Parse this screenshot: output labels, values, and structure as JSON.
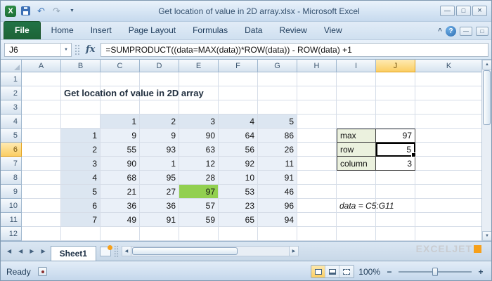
{
  "window": {
    "title": "Get location of value in 2D array.xlsx  -  Microsoft Excel"
  },
  "ribbon": {
    "tabs": [
      {
        "label": "File",
        "style": "file"
      },
      {
        "label": "Home"
      },
      {
        "label": "Insert"
      },
      {
        "label": "Page Layout"
      },
      {
        "label": "Formulas"
      },
      {
        "label": "Data"
      },
      {
        "label": "Review"
      },
      {
        "label": "View"
      }
    ]
  },
  "formula_bar": {
    "name_box": "J6",
    "fx_label": "fx",
    "formula": "=SUMPRODUCT((data=MAX(data))*ROW(data)) - ROW(data) +1"
  },
  "sheet": {
    "columns": [
      "A",
      "B",
      "C",
      "D",
      "E",
      "F",
      "G",
      "H",
      "I",
      "J",
      "K"
    ],
    "rows": [
      "1",
      "2",
      "3",
      "4",
      "5",
      "6",
      "7",
      "8",
      "9",
      "10",
      "11",
      "12"
    ],
    "selected_cell": "J6",
    "selected_column": "J",
    "selected_row": "6",
    "cells": [
      {
        "ref": "B2",
        "text": "Get location of value in 2D array",
        "type": "title"
      },
      {
        "ref": "C4",
        "text": "1",
        "type": "thead"
      },
      {
        "ref": "D4",
        "text": "2",
        "type": "thead"
      },
      {
        "ref": "E4",
        "text": "3",
        "type": "thead"
      },
      {
        "ref": "F4",
        "text": "4",
        "type": "thead"
      },
      {
        "ref": "G4",
        "text": "5",
        "type": "thead"
      },
      {
        "ref": "B5",
        "text": "1",
        "type": "thead"
      },
      {
        "ref": "C5",
        "text": "9",
        "type": "tdata"
      },
      {
        "ref": "D5",
        "text": "9",
        "type": "tdata"
      },
      {
        "ref": "E5",
        "text": "90",
        "type": "tdata"
      },
      {
        "ref": "F5",
        "text": "64",
        "type": "tdata"
      },
      {
        "ref": "G5",
        "text": "86",
        "type": "tdata"
      },
      {
        "ref": "B6",
        "text": "2",
        "type": "thead"
      },
      {
        "ref": "C6",
        "text": "55",
        "type": "tdata"
      },
      {
        "ref": "D6",
        "text": "93",
        "type": "tdata"
      },
      {
        "ref": "E6",
        "text": "63",
        "type": "tdata"
      },
      {
        "ref": "F6",
        "text": "56",
        "type": "tdata"
      },
      {
        "ref": "G6",
        "text": "26",
        "type": "tdata"
      },
      {
        "ref": "B7",
        "text": "3",
        "type": "thead"
      },
      {
        "ref": "C7",
        "text": "90",
        "type": "tdata"
      },
      {
        "ref": "D7",
        "text": "1",
        "type": "tdata"
      },
      {
        "ref": "E7",
        "text": "12",
        "type": "tdata"
      },
      {
        "ref": "F7",
        "text": "92",
        "type": "tdata"
      },
      {
        "ref": "G7",
        "text": "11",
        "type": "tdata"
      },
      {
        "ref": "B8",
        "text": "4",
        "type": "thead"
      },
      {
        "ref": "C8",
        "text": "68",
        "type": "tdata"
      },
      {
        "ref": "D8",
        "text": "95",
        "type": "tdata"
      },
      {
        "ref": "E8",
        "text": "28",
        "type": "tdata"
      },
      {
        "ref": "F8",
        "text": "10",
        "type": "tdata"
      },
      {
        "ref": "G8",
        "text": "91",
        "type": "tdata"
      },
      {
        "ref": "B9",
        "text": "5",
        "type": "thead"
      },
      {
        "ref": "C9",
        "text": "21",
        "type": "tdata"
      },
      {
        "ref": "D9",
        "text": "27",
        "type": "tdata"
      },
      {
        "ref": "E9",
        "text": "97",
        "type": "tdata max"
      },
      {
        "ref": "F9",
        "text": "53",
        "type": "tdata"
      },
      {
        "ref": "G9",
        "text": "46",
        "type": "tdata"
      },
      {
        "ref": "B10",
        "text": "6",
        "type": "thead"
      },
      {
        "ref": "C10",
        "text": "36",
        "type": "tdata"
      },
      {
        "ref": "D10",
        "text": "36",
        "type": "tdata"
      },
      {
        "ref": "E10",
        "text": "57",
        "type": "tdata"
      },
      {
        "ref": "F10",
        "text": "23",
        "type": "tdata"
      },
      {
        "ref": "G10",
        "text": "96",
        "type": "tdata"
      },
      {
        "ref": "B11",
        "text": "7",
        "type": "thead"
      },
      {
        "ref": "C11",
        "text": "49",
        "type": "tdata"
      },
      {
        "ref": "D11",
        "text": "91",
        "type": "tdata"
      },
      {
        "ref": "E11",
        "text": "59",
        "type": "tdata"
      },
      {
        "ref": "F11",
        "text": "65",
        "type": "tdata"
      },
      {
        "ref": "G11",
        "text": "94",
        "type": "tdata"
      },
      {
        "ref": "I5",
        "text": "max",
        "type": "rlabel rt"
      },
      {
        "ref": "J5",
        "text": "97",
        "type": "rvalue rt"
      },
      {
        "ref": "I6",
        "text": "row",
        "type": "rlabel"
      },
      {
        "ref": "J6",
        "text": "5",
        "type": "rvalue"
      },
      {
        "ref": "I7",
        "text": "column",
        "type": "rlabel"
      },
      {
        "ref": "J7",
        "text": "3",
        "type": "rvalue"
      },
      {
        "ref": "I10",
        "text": "data = C5:G11",
        "type": "note"
      }
    ]
  },
  "sheet_tabs": {
    "tabs": [
      {
        "label": "Sheet1",
        "active": true
      }
    ]
  },
  "status_bar": {
    "mode": "Ready",
    "zoom_level": "100%"
  },
  "logo": {
    "text": "EXCELJET"
  },
  "icons": {
    "excel_logo": "X",
    "undo": "↶",
    "redo": "↷",
    "qat_menu": "▼",
    "minimize": "—",
    "maximize": "□",
    "close": "×",
    "ribbon_collapse": "^",
    "help": "?",
    "name_box_caret": "▼",
    "nav_first": "◀",
    "nav_prev": "◀",
    "nav_next": "▶",
    "nav_last": "▶",
    "scroll_up": "▲",
    "scroll_down": "▼",
    "scroll_left": "◀",
    "scroll_right": "▶",
    "zoom_out": "−",
    "zoom_in": "+"
  },
  "colors": {
    "file_tab": "#217346",
    "max_highlight": "#92d050",
    "selection_header": "#fbce63",
    "logo_orange": "#f6a01a"
  }
}
